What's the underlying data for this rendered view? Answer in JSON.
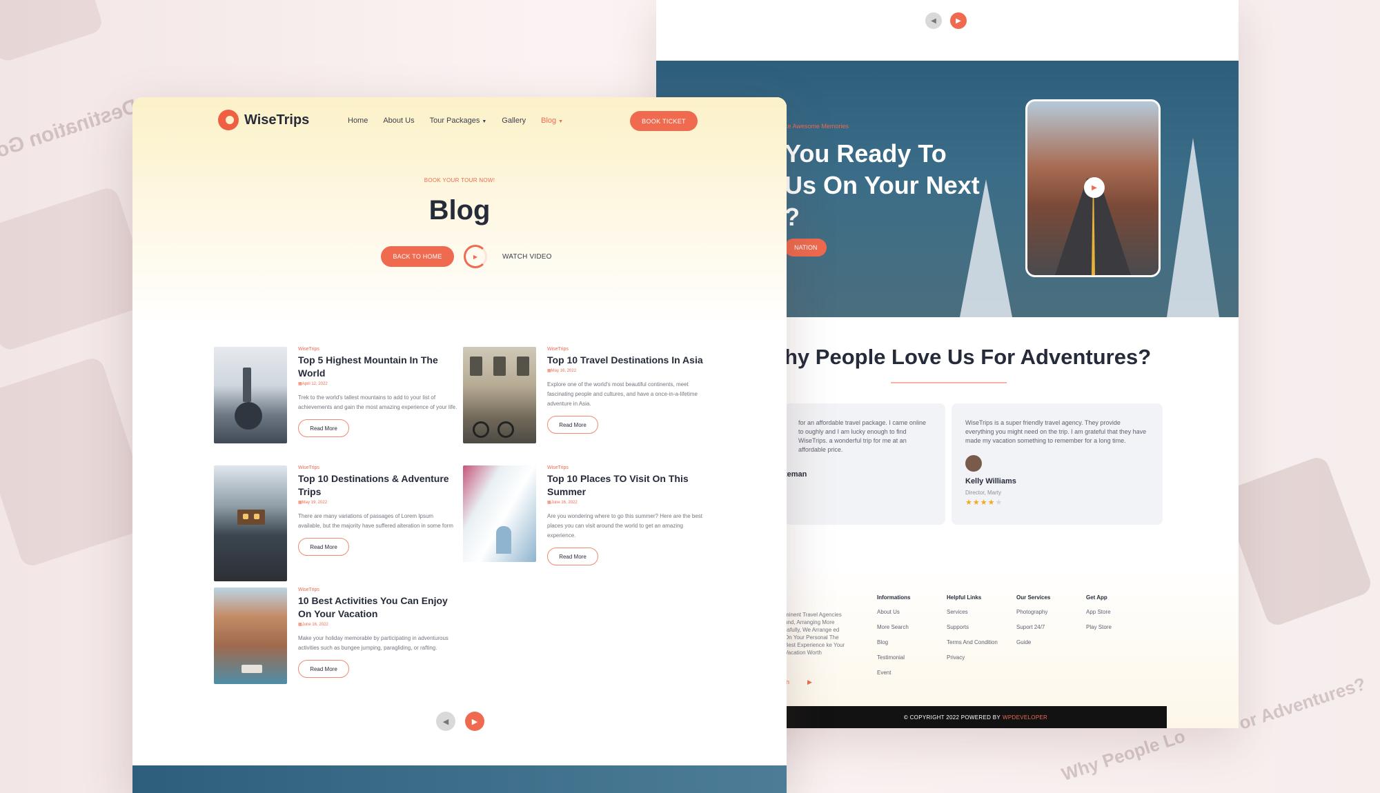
{
  "site": {
    "brand": "WiseTrips",
    "accent_color": "#ef6a4f",
    "nav": [
      "Home",
      "About Us",
      "Tour Packages",
      "Gallery",
      "Blog"
    ],
    "book_ticket": "BOOK TICKET"
  },
  "hero": {
    "eyebrow": "BOOK YOUR TOUR NOW!",
    "title": "Blog",
    "back_home": "BACK TO HOME",
    "watch_video": "WATCH VIDEO"
  },
  "posts": [
    {
      "category": "WiseTrips",
      "title": "Top 5 Highest Mountain In The World",
      "date": "April 12, 2022",
      "excerpt": "Trek to the world's tallest mountains to add to your list of achievements and gain the most amazing experience of your life.",
      "read_more": "Read More"
    },
    {
      "category": "WiseTrips",
      "title": "Top 10 Travel Destinations In Asia",
      "date": "May 16, 2022",
      "excerpt": "Explore one of the world's most beautiful continents, meet fascinating people and cultures, and have a once-in-a-lifetime adventure in Asia.",
      "read_more": "Read More"
    },
    {
      "category": "WiseTrips",
      "title": "Top 10 Destinations & Adventure Trips",
      "date": "May 19, 2022",
      "excerpt": "There are many variations of passages of Lorem Ipsum available, but the majority have suffered alteration in some form",
      "read_more": "Read More"
    },
    {
      "category": "WiseTrips",
      "title": "Top 10 Places TO Visit On This Summer",
      "date": "June 16, 2022",
      "excerpt": "Are you wondering where to go this summer? Here are the best places you can visit around the world to get an amazing experience.",
      "read_more": "Read More"
    },
    {
      "category": "WiseTrips",
      "title": "10 Best Activities You Can Enjoy On Your Vacation",
      "date": "June 16, 2022",
      "excerpt": "Make your holiday memorable by participating in adventurous activities such as bungee jumping, paragliding, or rafting.",
      "read_more": "Read More"
    }
  ],
  "pager": {
    "prev_icon": "chevron-left-icon",
    "next_icon": "chevron-right-icon"
  },
  "back_page": {
    "hero_sub": "ke Awesome Memories",
    "hero_title_line1": "You Ready To",
    "hero_title_line2": "Us On Your Next",
    "hero_title_line3": "?",
    "hero_btn": "NATION",
    "section_title": "hy People Love Us For Adventures?",
    "testimonials": [
      {
        "text": "for an affordable travel package. I came online to oughly and I am lucky enough to find WiseTrips. a wonderful trip for me at an affordable price.",
        "name": "teman"
      },
      {
        "text": "WiseTrips is a super friendly travel agency. They provide everything you might need on the trip. I am grateful that they have made my vacation something to remember for a long time.",
        "name": "Kelly Williams",
        "role": "Director, Marty",
        "rating": 4,
        "stars": "★★★★★"
      }
    ],
    "footer_about": "minent Travel Agencies und, Arranging More ssfully, We Arrange ed On Your Personal The Best Experience ke Your Vacation Worth",
    "footer_columns": [
      {
        "title": "Informations",
        "links": [
          "About Us",
          "More Search",
          "Blog",
          "Testimonial",
          "Event"
        ]
      },
      {
        "title": "Helpful Links",
        "links": [
          "Services",
          "Supports",
          "Terms And Condition",
          "Privacy"
        ]
      },
      {
        "title": "Our Services",
        "links": [
          "Photography",
          "Suport 24/7",
          "Guide"
        ]
      },
      {
        "title": "Get App",
        "links": [
          "App Store",
          "Play Store"
        ]
      }
    ],
    "copyright": "© COPYRIGHT 2022 POWERED BY",
    "copyright_brand": "WPDEVELOPER"
  },
  "background_text": {
    "left": "Destination Go",
    "right": "or Adventures?",
    "bottom": "Why People Lo"
  }
}
